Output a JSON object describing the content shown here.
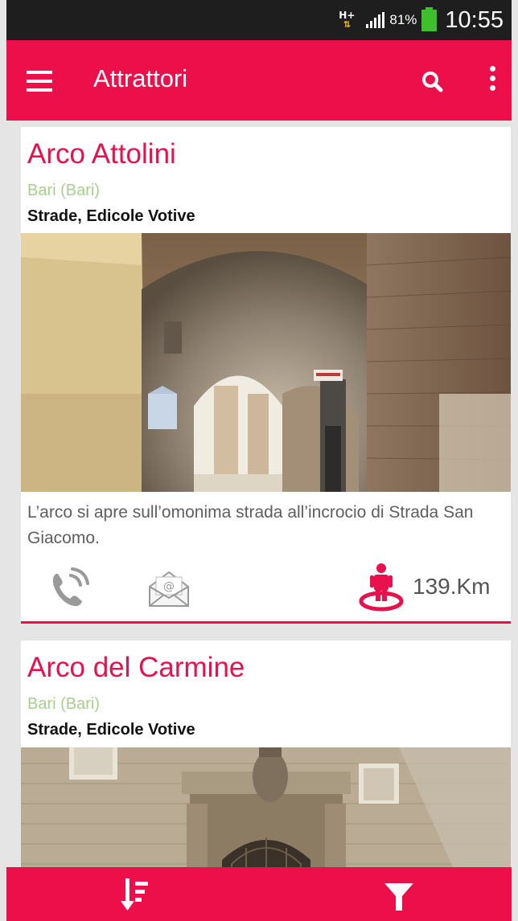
{
  "status_bar": {
    "network": "H+",
    "battery_percent": "81%",
    "time": "10:55"
  },
  "app_bar": {
    "title": "Attrattori",
    "icons": [
      "menu-icon",
      "search-icon",
      "more-vert-icon"
    ]
  },
  "attractions": [
    {
      "title": "Arco Attolini",
      "city": "Bari (Bari)",
      "category": "Strade, Edicole Votive",
      "description": "L’arco si apre sull’omonima strada all’incrocio di Strada San Giacomo.",
      "distance": "139.Km",
      "actions": [
        "phone-icon",
        "mail-icon",
        "distance-icon"
      ]
    },
    {
      "title": "Arco del Carmine",
      "city": "Bari (Bari)",
      "category": "Strade, Edicole Votive"
    }
  ],
  "bottom_bar": {
    "icons": [
      "sort-icon",
      "filter-icon"
    ]
  },
  "colors": {
    "primary": "#ec0f4a",
    "title": "#e8114e",
    "city": "#a7cf8e",
    "status_bar": "#1e1e1e",
    "background": "#e5e5e5"
  }
}
